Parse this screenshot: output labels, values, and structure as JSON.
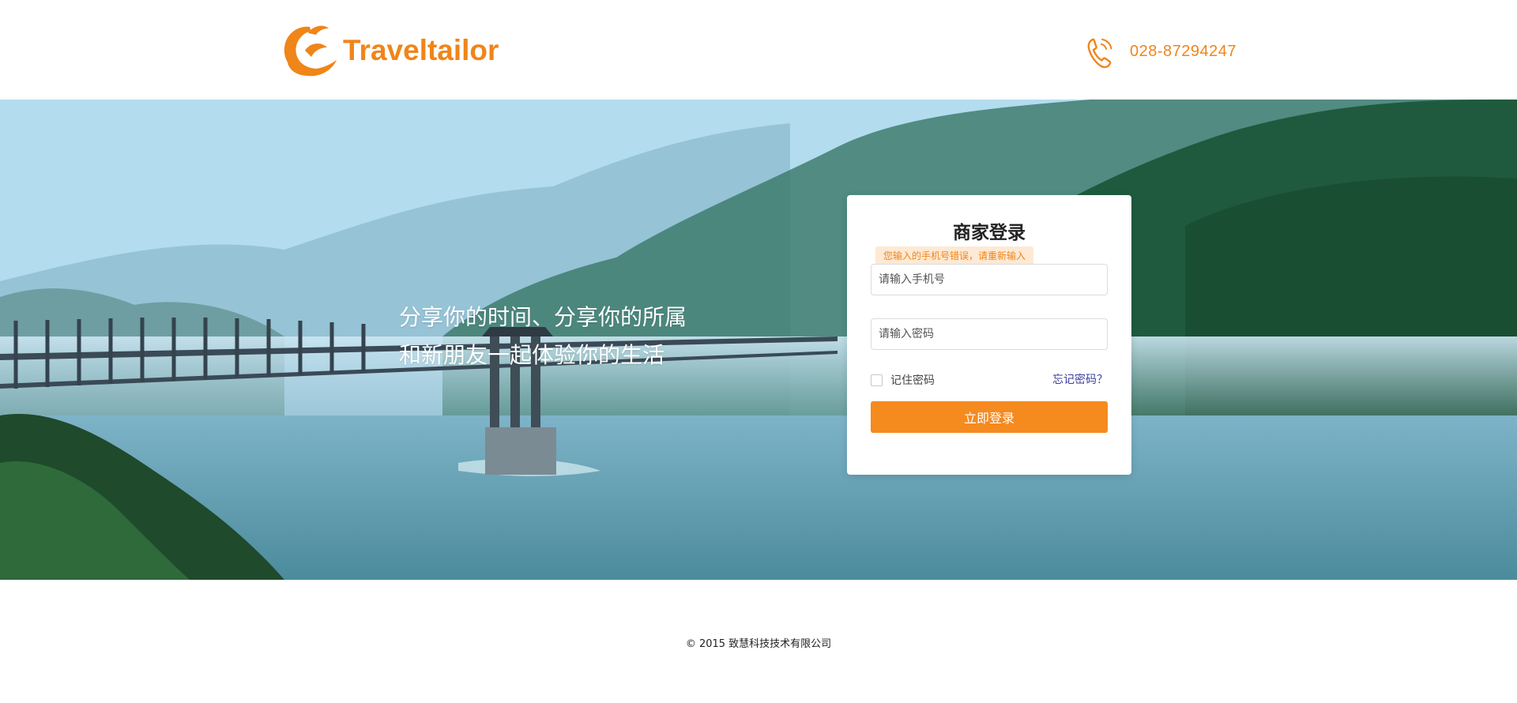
{
  "header": {
    "logo_text": "Traveltailor",
    "phone": "028-87294247"
  },
  "hero": {
    "slogan_line1": "分享你的时间、分享你的所属",
    "slogan_line2": "和新朋友一起体验你的生活"
  },
  "login": {
    "title": "商家登录",
    "error_tip": "您输入的手机号错误，请重新输入",
    "phone_placeholder": "请输入手机号",
    "password_placeholder": "请输入密码",
    "remember_label": "记住密码",
    "forgot_label": "忘记密码？",
    "submit_label": "立即登录"
  },
  "footer": {
    "copyright": "© 2015 致慧科技技术有限公司"
  },
  "colors": {
    "brand_orange": "#f08519",
    "button_orange": "#f58a1f",
    "link_blue": "#3b3f9a"
  },
  "icons": {
    "logo": "bird-swoosh-logo",
    "phone": "phone-ringing-icon"
  }
}
